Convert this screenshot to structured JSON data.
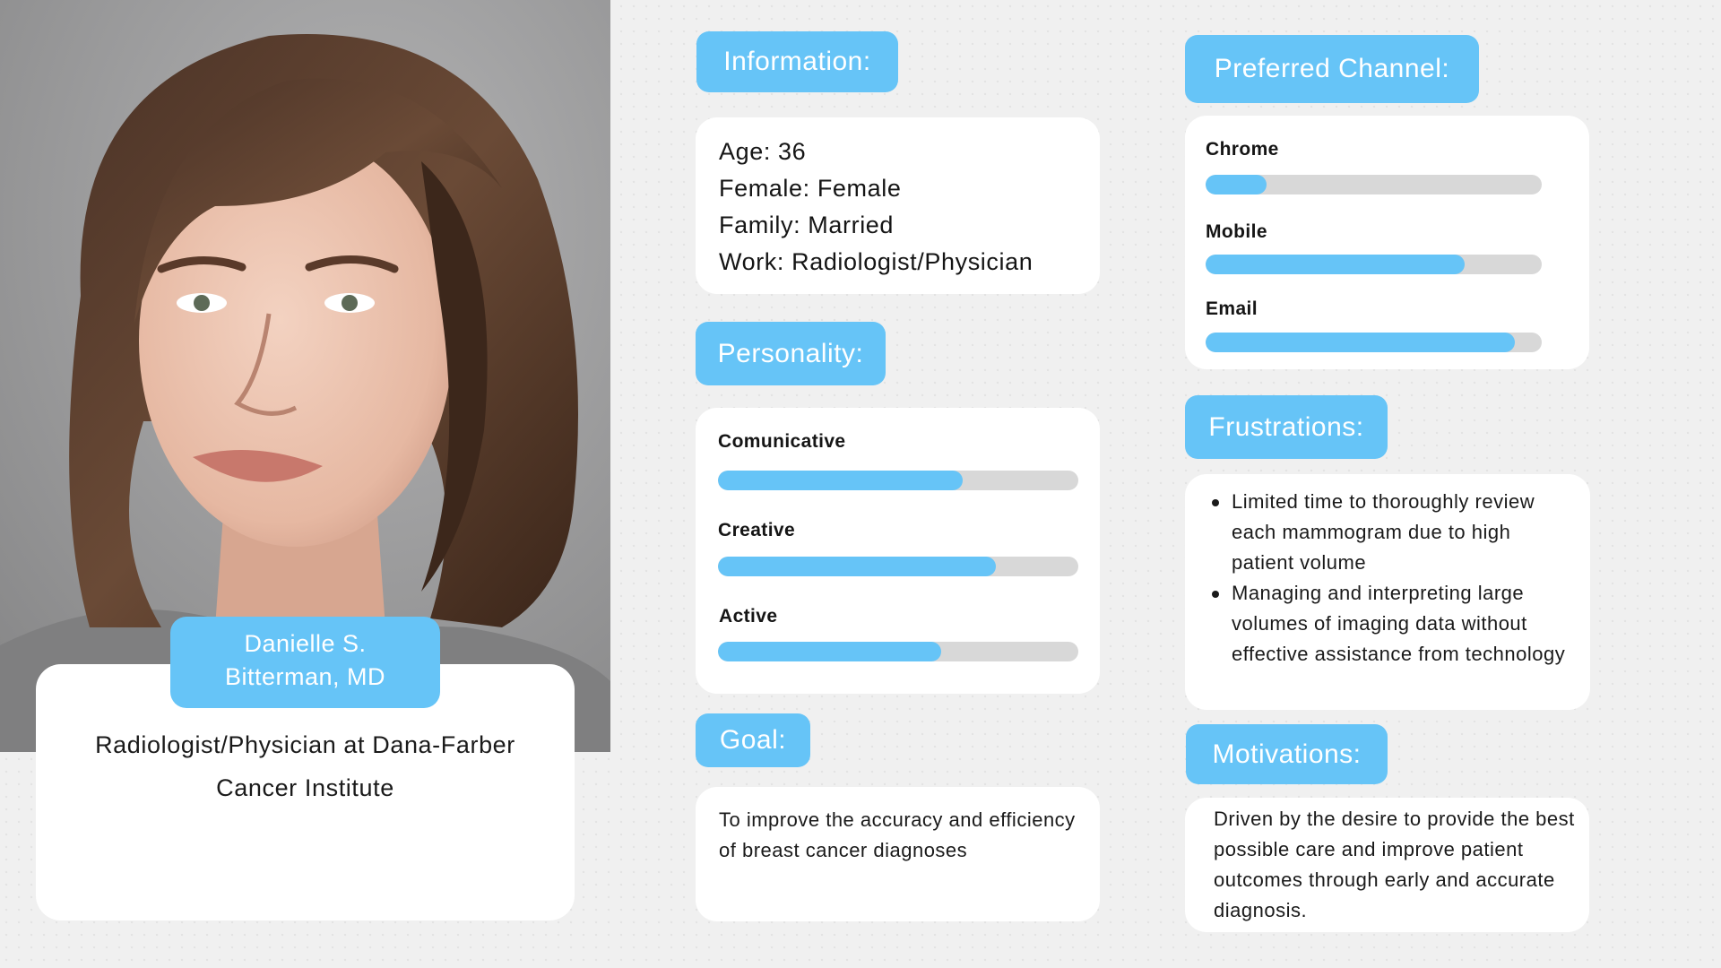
{
  "profile": {
    "name_line1": "Danielle S.",
    "name_line2": "Bitterman, MD",
    "description": "Radiologist/Physician at Dana-Farber Cancer Institute"
  },
  "information": {
    "title": "Information:",
    "lines": [
      "Age: 36",
      "Female: Female",
      "Family: Married",
      "Work: Radiologist/Physician"
    ]
  },
  "personality": {
    "title": "Personality:",
    "traits": [
      {
        "label": "Comunicative",
        "level": 0.68
      },
      {
        "label": "Creative",
        "level": 0.77
      },
      {
        "label": "Active",
        "level": 0.62
      }
    ]
  },
  "goal": {
    "title": "Goal:",
    "text": "To improve the accuracy and efficiency of breast cancer diagnoses"
  },
  "channels": {
    "title": "Preferred Channel:",
    "items": [
      {
        "label": "Chrome",
        "level": 0.18
      },
      {
        "label": "Mobile",
        "level": 0.77
      },
      {
        "label": "Email",
        "level": 0.92
      }
    ]
  },
  "frustrations": {
    "title": "Frustrations:",
    "items": [
      "Limited time to thoroughly review each mammogram due to high patient volume",
      "Managing and interpreting large volumes of imaging data without effective assistance from technology"
    ]
  },
  "motivations": {
    "title": "Motivations:",
    "text": "Driven by the desire to provide the best possible care and improve patient outcomes through early and accurate diagnosis."
  },
  "colors": {
    "accent": "#66c4f7",
    "track": "#d8d8d8",
    "card": "#ffffff"
  }
}
